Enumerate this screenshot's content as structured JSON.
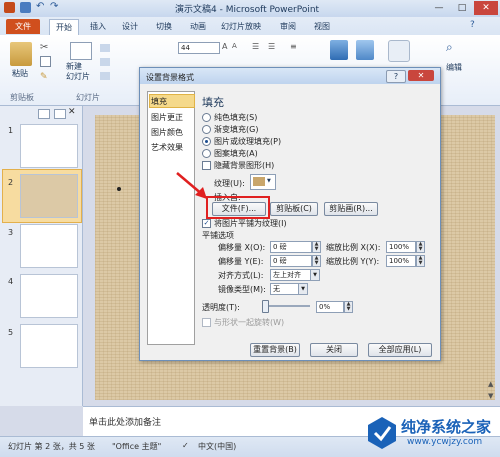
{
  "window": {
    "title": "演示文稿4 - Microsoft PowerPoint",
    "minimize": "—",
    "maximize": "□",
    "close": "✕"
  },
  "ribbon_tabs": [
    "文件",
    "开始",
    "插入",
    "设计",
    "切换",
    "动画",
    "幻灯片放映",
    "审阅",
    "视图"
  ],
  "ribbon": {
    "paste_label": "粘贴",
    "new_slide_label": "新建\n幻灯片",
    "edit_label": "编辑",
    "font_size": "44",
    "groups": [
      "剪贴板",
      "幻灯片"
    ]
  },
  "slides": [
    {
      "num": "1"
    },
    {
      "num": "2"
    },
    {
      "num": "3"
    },
    {
      "num": "4"
    },
    {
      "num": "5"
    }
  ],
  "notes_placeholder": "单击此处添加备注",
  "status": {
    "slide_info": "幻灯片 第 2 张，共 5 张",
    "theme": "\"Office 主题\"",
    "language": "中文(中国)"
  },
  "dialog": {
    "title": "设置背景格式",
    "help": "?",
    "close": "✕",
    "nav": [
      "填充",
      "图片更正",
      "图片颜色",
      "艺术效果"
    ],
    "section_title": "填充",
    "fill_options": [
      {
        "label": "纯色填充(S)",
        "selected": false
      },
      {
        "label": "渐变填充(G)",
        "selected": false
      },
      {
        "label": "图片或纹理填充(P)",
        "selected": true
      },
      {
        "label": "图案填充(A)",
        "selected": false
      }
    ],
    "hide_bg_graphics": "隐藏背景图形(H)",
    "texture_label": "纹理(U):",
    "insert_from": "插入自:",
    "btn_file": "文件(F)...",
    "btn_clipboard": "剪贴板(C)",
    "btn_clipart": "剪贴画(R)...",
    "tile_checkbox": "将图片平铺为纹理(I)",
    "tile_options": "平铺选项",
    "offset_x_label": "偏移量 X(O):",
    "offset_x_value": "0 磅",
    "offset_y_label": "偏移量 Y(E):",
    "offset_y_value": "0 磅",
    "scale_x_label": "缩放比例 X(X):",
    "scale_x_value": "100%",
    "scale_y_label": "缩放比例 Y(Y):",
    "scale_y_value": "100%",
    "align_label": "对齐方式(L):",
    "align_value": "左上对齐",
    "mirror_label": "镜像类型(M):",
    "mirror_value": "无",
    "transparency_label": "透明度(T):",
    "transparency_value": "0%",
    "transparency_level": 0,
    "rotate_with_shape": "与形状一起旋转(W)",
    "btn_reset": "重置背景(B)",
    "btn_close": "关闭",
    "btn_apply_all": "全部应用(L)"
  },
  "watermark": {
    "title": "纯净系统之家",
    "url": "www.ycwjzy.com"
  },
  "colors": {
    "file_tab": "#d04f1d",
    "highlight": "#e02020",
    "watermark_blue": "#1a62b8"
  }
}
